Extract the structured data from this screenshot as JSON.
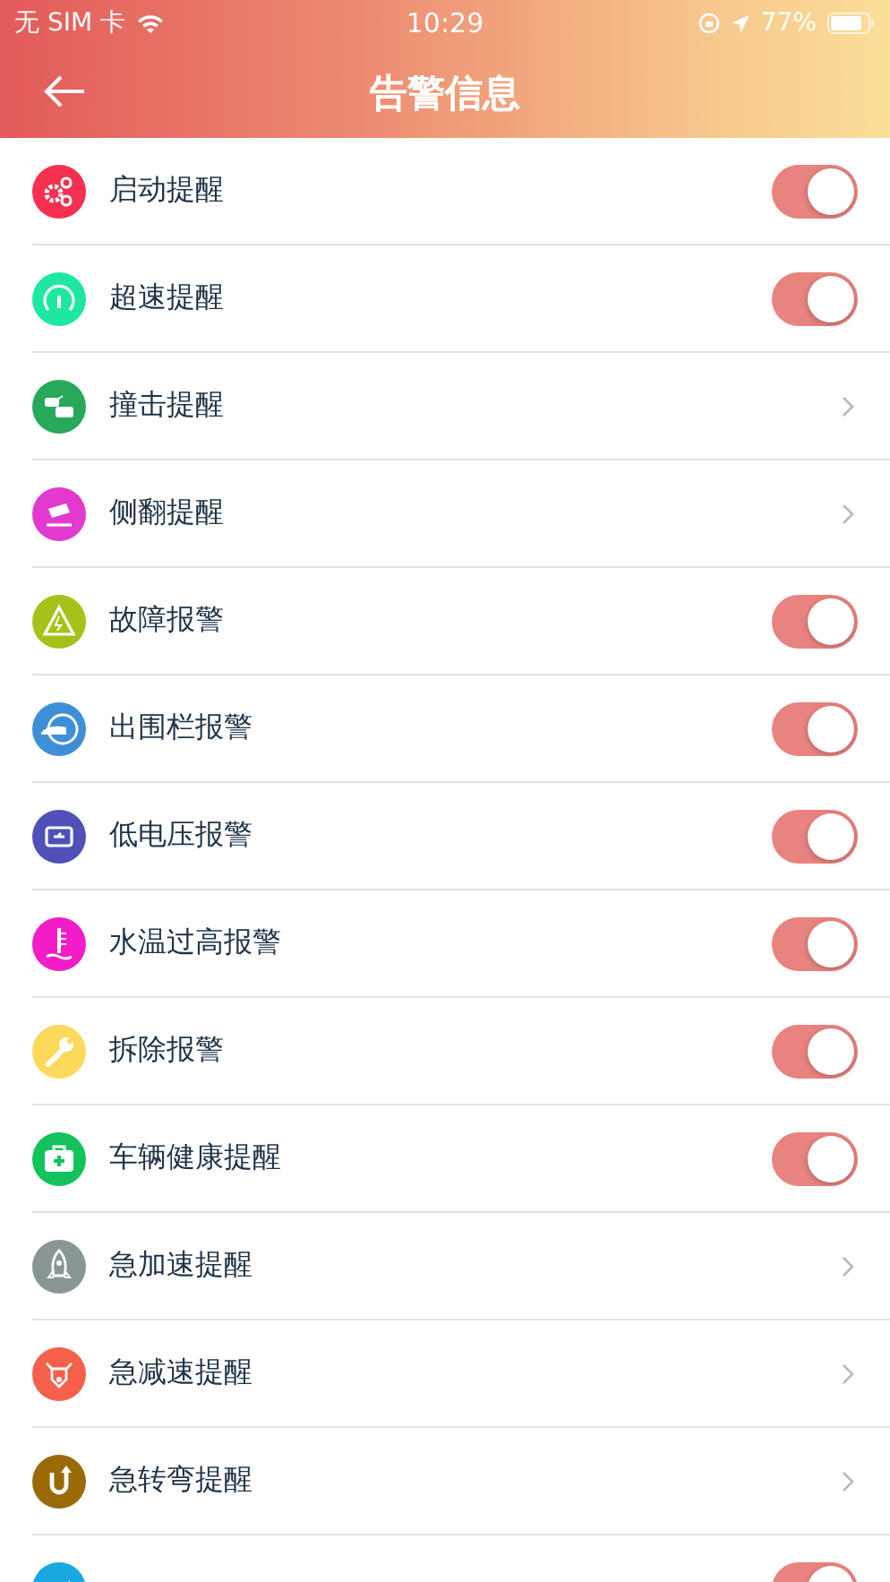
{
  "status_bar": {
    "carrier": "无 SIM 卡",
    "time": "10:29",
    "battery": "77%"
  },
  "header": {
    "title": "告警信息"
  },
  "items": [
    {
      "label": "启动提醒",
      "color": "#f5304f",
      "kind": "toggle",
      "on": true
    },
    {
      "label": "超速提醒",
      "color": "#1ee8a0",
      "kind": "toggle",
      "on": true
    },
    {
      "label": "撞击提醒",
      "color": "#27a85a",
      "kind": "link"
    },
    {
      "label": "侧翻提醒",
      "color": "#e23ad0",
      "kind": "link"
    },
    {
      "label": "故障报警",
      "color": "#a5c21a",
      "kind": "toggle",
      "on": true
    },
    {
      "label": "出围栏报警",
      "color": "#3f8fd8",
      "kind": "toggle",
      "on": true
    },
    {
      "label": "低电压报警",
      "color": "#5050b8",
      "kind": "toggle",
      "on": true
    },
    {
      "label": "水温过高报警",
      "color": "#f21cc8",
      "kind": "toggle",
      "on": true
    },
    {
      "label": "拆除报警",
      "color": "#fcd95a",
      "kind": "toggle",
      "on": true
    },
    {
      "label": "车辆健康提醒",
      "color": "#13c25c",
      "kind": "toggle",
      "on": true
    },
    {
      "label": "急加速提醒",
      "color": "#8a9597",
      "kind": "link"
    },
    {
      "label": "急减速提醒",
      "color": "#f5604a",
      "kind": "link"
    },
    {
      "label": "急转弯提醒",
      "color": "#9a6a06",
      "kind": "link"
    },
    {
      "color": "#1aa8e0",
      "kind": "toggle",
      "on": true
    }
  ]
}
